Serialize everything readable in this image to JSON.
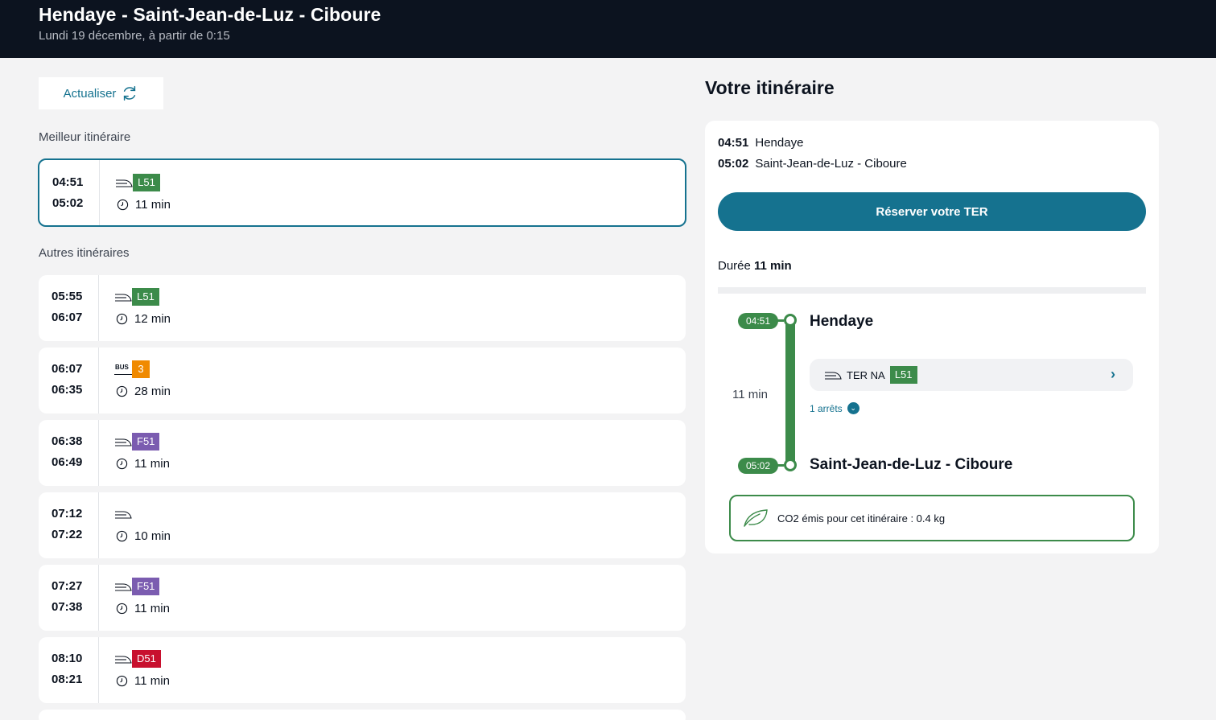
{
  "header": {
    "title": "Hendaye - Saint-Jean-de-Luz - Ciboure",
    "subtitle": "Lundi 19 décembre, à partir de 0:15"
  },
  "refresh": {
    "label": "Actualiser"
  },
  "best_label": "Meilleur itinéraire",
  "others_label": "Autres itinéraires",
  "best": {
    "dep": "04:51",
    "arr": "05:02",
    "mode": "train",
    "line": "L51",
    "line_color": "#3c8b4a",
    "duration": "11 min"
  },
  "others": [
    {
      "dep": "05:55",
      "arr": "06:07",
      "mode": "train",
      "line": "L51",
      "line_color": "#3c8b4a",
      "duration": "12 min"
    },
    {
      "dep": "06:07",
      "arr": "06:35",
      "mode": "bus",
      "mode_label": "BUS",
      "line": "3",
      "line_color": "#f08a00",
      "duration": "28 min"
    },
    {
      "dep": "06:38",
      "arr": "06:49",
      "mode": "train",
      "line": "F51",
      "line_color": "#7b5cb0",
      "duration": "11 min"
    },
    {
      "dep": "07:12",
      "arr": "07:22",
      "mode": "train",
      "line": "",
      "line_color": "",
      "duration": "10 min"
    },
    {
      "dep": "07:27",
      "arr": "07:38",
      "mode": "train",
      "line": "F51",
      "line_color": "#7b5cb0",
      "duration": "11 min"
    },
    {
      "dep": "08:10",
      "arr": "08:21",
      "mode": "train",
      "line": "D51",
      "line_color": "#c8102e",
      "duration": "11 min"
    }
  ],
  "itinerary": {
    "title": "Votre itinéraire",
    "dep_time": "04:51",
    "dep_station": "Hendaye",
    "arr_time": "05:02",
    "arr_station": "Saint-Jean-de-Luz - Ciboure",
    "book_label": "Réserver votre TER",
    "duration_label": "Durée",
    "duration_value": "11 min",
    "leg": {
      "network": "TER NA",
      "line": "L51",
      "line_color": "#3c8b4a",
      "duration": "11 min",
      "stops_label": "1 arrêts"
    },
    "co2_text": "CO2 émis pour cet itinéraire : 0.4 kg"
  },
  "icons": [
    "train-icon",
    "bus-icon",
    "clock-icon",
    "refresh-icon",
    "chevron-right-icon",
    "chevron-down-icon",
    "leaf-icon"
  ],
  "colors": {
    "header_bg": "#0c131f",
    "accent": "#15728f",
    "green": "#3c8b4a"
  }
}
